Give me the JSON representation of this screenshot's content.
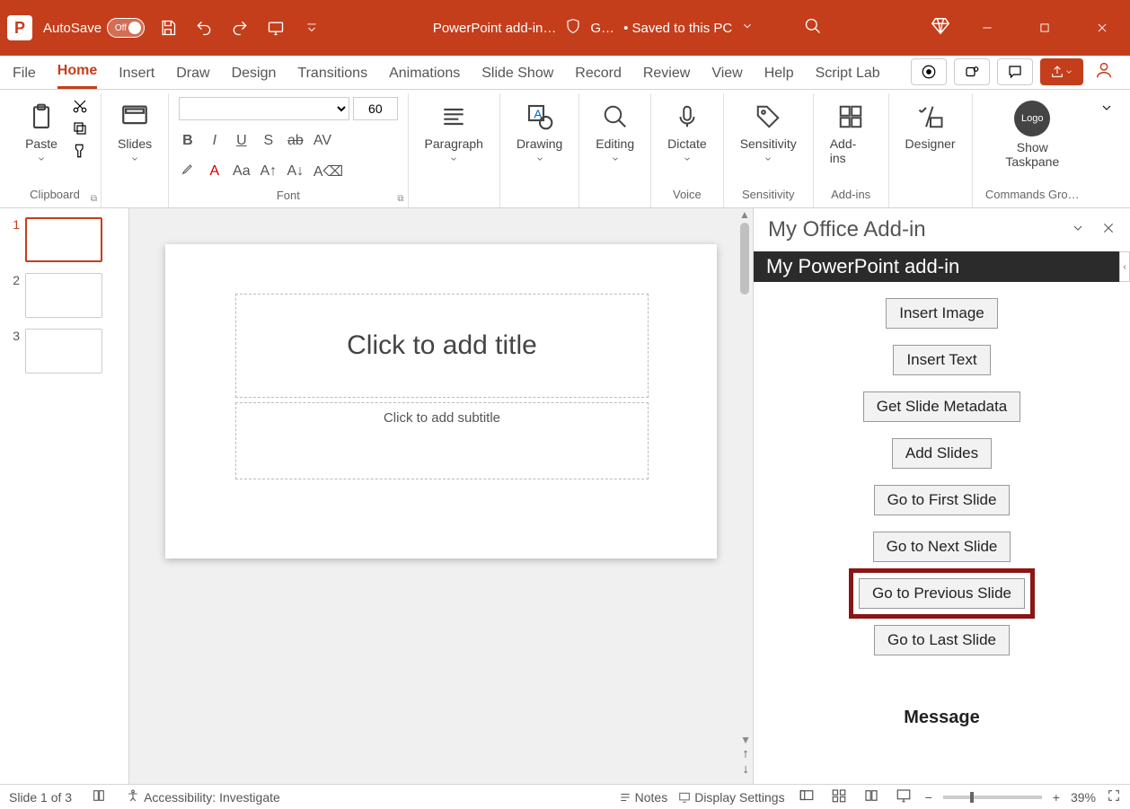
{
  "title": {
    "autosave_label": "AutoSave",
    "autosave_state": "Off",
    "doc_name": "PowerPoint add-in…",
    "shield_text": "G…",
    "save_status": "• Saved to this PC"
  },
  "tabs": [
    "File",
    "Home",
    "Insert",
    "Draw",
    "Design",
    "Transitions",
    "Animations",
    "Slide Show",
    "Record",
    "Review",
    "View",
    "Help",
    "Script Lab"
  ],
  "active_tab": "Home",
  "ribbon": {
    "clipboard_label": "Clipboard",
    "paste_label": "Paste",
    "slides_label": "Slides",
    "font_label": "Font",
    "font_size_value": "60",
    "paragraph_label": "Paragraph",
    "drawing_label": "Drawing",
    "editing_label": "Editing",
    "dictate_label": "Dictate",
    "voice_label": "Voice",
    "sensitivity_label": "Sensitivity",
    "sensitivity_group_label": "Sensitivity",
    "addins_label": "Add-ins",
    "addins_group_label": "Add-ins",
    "designer_label": "Designer",
    "show_taskpane_label": "Show Taskpane",
    "commands_group_label": "Commands Gro…",
    "logo_text": "Logo"
  },
  "thumbs": [
    {
      "num": "1",
      "active": true
    },
    {
      "num": "2",
      "active": false
    },
    {
      "num": "3",
      "active": false
    }
  ],
  "slide": {
    "title_placeholder": "Click to add title",
    "subtitle_placeholder": "Click to add subtitle"
  },
  "taskpane": {
    "pane_title": "My Office Add-in",
    "sub_title": "My PowerPoint add-in",
    "buttons": [
      "Insert Image",
      "Insert Text",
      "Get Slide Metadata",
      "Add Slides",
      "Go to First Slide",
      "Go to Next Slide",
      "Go to Previous Slide",
      "Go to Last Slide"
    ],
    "highlight_index": 6,
    "message_label": "Message"
  },
  "status": {
    "slide_counter": "Slide 1 of 3",
    "accessibility": "Accessibility: Investigate",
    "notes_label": "Notes",
    "display_label": "Display Settings",
    "zoom_value": "39%"
  }
}
